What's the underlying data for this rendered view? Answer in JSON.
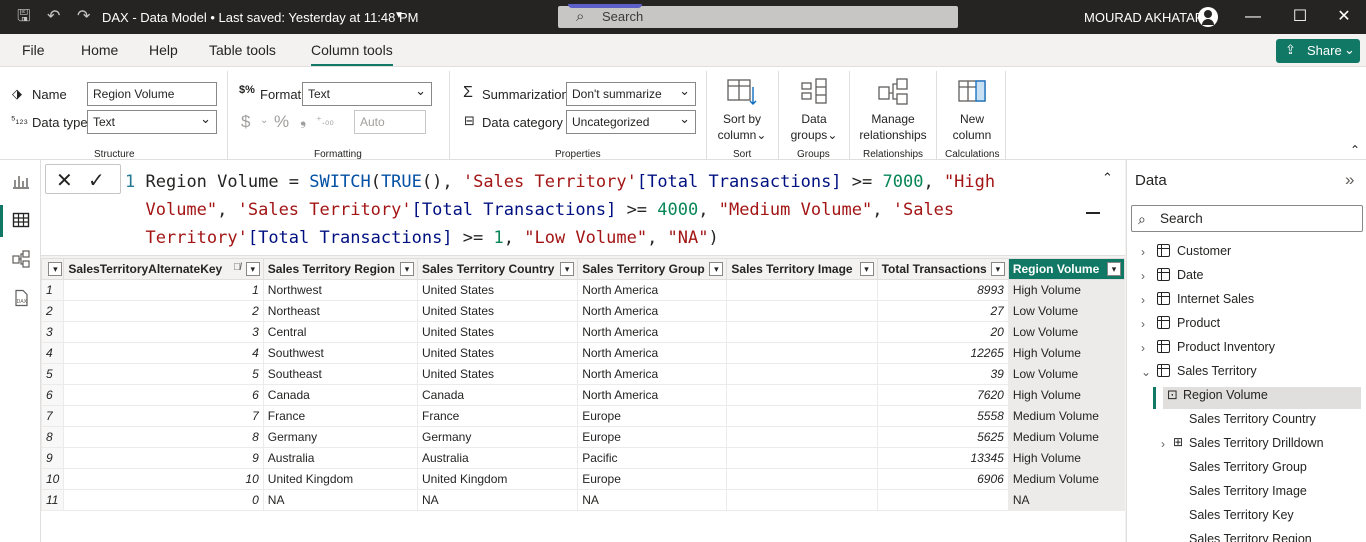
{
  "titlebar": {
    "title": "DAX - Data Model • Last saved: Yesterday at 11:48 PM",
    "search_placeholder": "Search",
    "user": "MOURAD AKHATAR"
  },
  "menu": {
    "tabs": [
      "File",
      "Home",
      "Help",
      "Table tools",
      "Column tools"
    ],
    "active": "Column tools",
    "share_label": "Share"
  },
  "ribbon": {
    "structure": {
      "name_label": "Name",
      "name_value": "Region Volume",
      "datatype_label": "Data type",
      "datatype_value": "Text",
      "group": "Structure"
    },
    "formatting": {
      "format_label": "Format",
      "format_value": "Text",
      "auto_value": "Auto",
      "group": "Formatting"
    },
    "properties": {
      "summarization_label": "Summarization",
      "summarization_value": "Don't summarize",
      "category_label": "Data category",
      "category_value": "Uncategorized",
      "group": "Properties"
    },
    "sort": {
      "label1": "Sort by",
      "label2": "column",
      "group": "Sort"
    },
    "groups": {
      "label1": "Data",
      "label2": "groups",
      "group": "Groups"
    },
    "relationships": {
      "label1": "Manage",
      "label2": "relationships",
      "group": "Relationships"
    },
    "calculations": {
      "label1": "New",
      "label2": "column",
      "group": "Calculations"
    }
  },
  "formula": {
    "line_number": "1"
  },
  "table": {
    "columns": [
      "SalesTerritoryAlternateKey",
      "Sales Territory Region",
      "Sales Territory Country",
      "Sales Territory Group",
      "Sales Territory Image",
      "Total Transactions",
      "Region Volume"
    ],
    "rows": [
      {
        "idx": "1",
        "key": "1",
        "region": "Northwest",
        "country": "United States",
        "group": "North America",
        "image": "",
        "total": "8993",
        "volume": "High Volume"
      },
      {
        "idx": "2",
        "key": "2",
        "region": "Northeast",
        "country": "United States",
        "group": "North America",
        "image": "",
        "total": "27",
        "volume": "Low Volume"
      },
      {
        "idx": "3",
        "key": "3",
        "region": "Central",
        "country": "United States",
        "group": "North America",
        "image": "",
        "total": "20",
        "volume": "Low Volume"
      },
      {
        "idx": "4",
        "key": "4",
        "region": "Southwest",
        "country": "United States",
        "group": "North America",
        "image": "",
        "total": "12265",
        "volume": "High Volume"
      },
      {
        "idx": "5",
        "key": "5",
        "region": "Southeast",
        "country": "United States",
        "group": "North America",
        "image": "",
        "total": "39",
        "volume": "Low Volume"
      },
      {
        "idx": "6",
        "key": "6",
        "region": "Canada",
        "country": "Canada",
        "group": "North America",
        "image": "",
        "total": "7620",
        "volume": "High Volume"
      },
      {
        "idx": "7",
        "key": "7",
        "region": "France",
        "country": "France",
        "group": "Europe",
        "image": "",
        "total": "5558",
        "volume": "Medium Volume"
      },
      {
        "idx": "8",
        "key": "8",
        "region": "Germany",
        "country": "Germany",
        "group": "Europe",
        "image": "",
        "total": "5625",
        "volume": "Medium Volume"
      },
      {
        "idx": "9",
        "key": "9",
        "region": "Australia",
        "country": "Australia",
        "group": "Pacific",
        "image": "",
        "total": "13345",
        "volume": "High Volume"
      },
      {
        "idx": "10",
        "key": "10",
        "region": "United Kingdom",
        "country": "United Kingdom",
        "group": "Europe",
        "image": "",
        "total": "6906",
        "volume": "Medium Volume"
      },
      {
        "idx": "11",
        "key": "0",
        "region": "NA",
        "country": "NA",
        "group": "NA",
        "image": "",
        "total": "",
        "volume": "NA"
      }
    ]
  },
  "data_pane": {
    "title": "Data",
    "search_placeholder": "Search",
    "items": [
      {
        "label": "Customer",
        "type": "table"
      },
      {
        "label": "Date",
        "type": "table"
      },
      {
        "label": "Internet Sales",
        "type": "table"
      },
      {
        "label": "Product",
        "type": "table"
      },
      {
        "label": "Product Inventory",
        "type": "table"
      },
      {
        "label": "Sales Territory",
        "type": "table-expanded"
      },
      {
        "label": "Region Volume",
        "type": "calc-column"
      },
      {
        "label": "Sales Territory Country",
        "type": "column"
      },
      {
        "label": "Sales Territory Drilldown",
        "type": "hierarchy"
      },
      {
        "label": "Sales Territory Group",
        "type": "column"
      },
      {
        "label": "Sales Territory Image",
        "type": "column"
      },
      {
        "label": "Sales Territory Key",
        "type": "column"
      },
      {
        "label": "Sales Territory Region",
        "type": "column"
      }
    ]
  },
  "colors": {
    "accent": "#117865",
    "titlebar": "#252423"
  }
}
